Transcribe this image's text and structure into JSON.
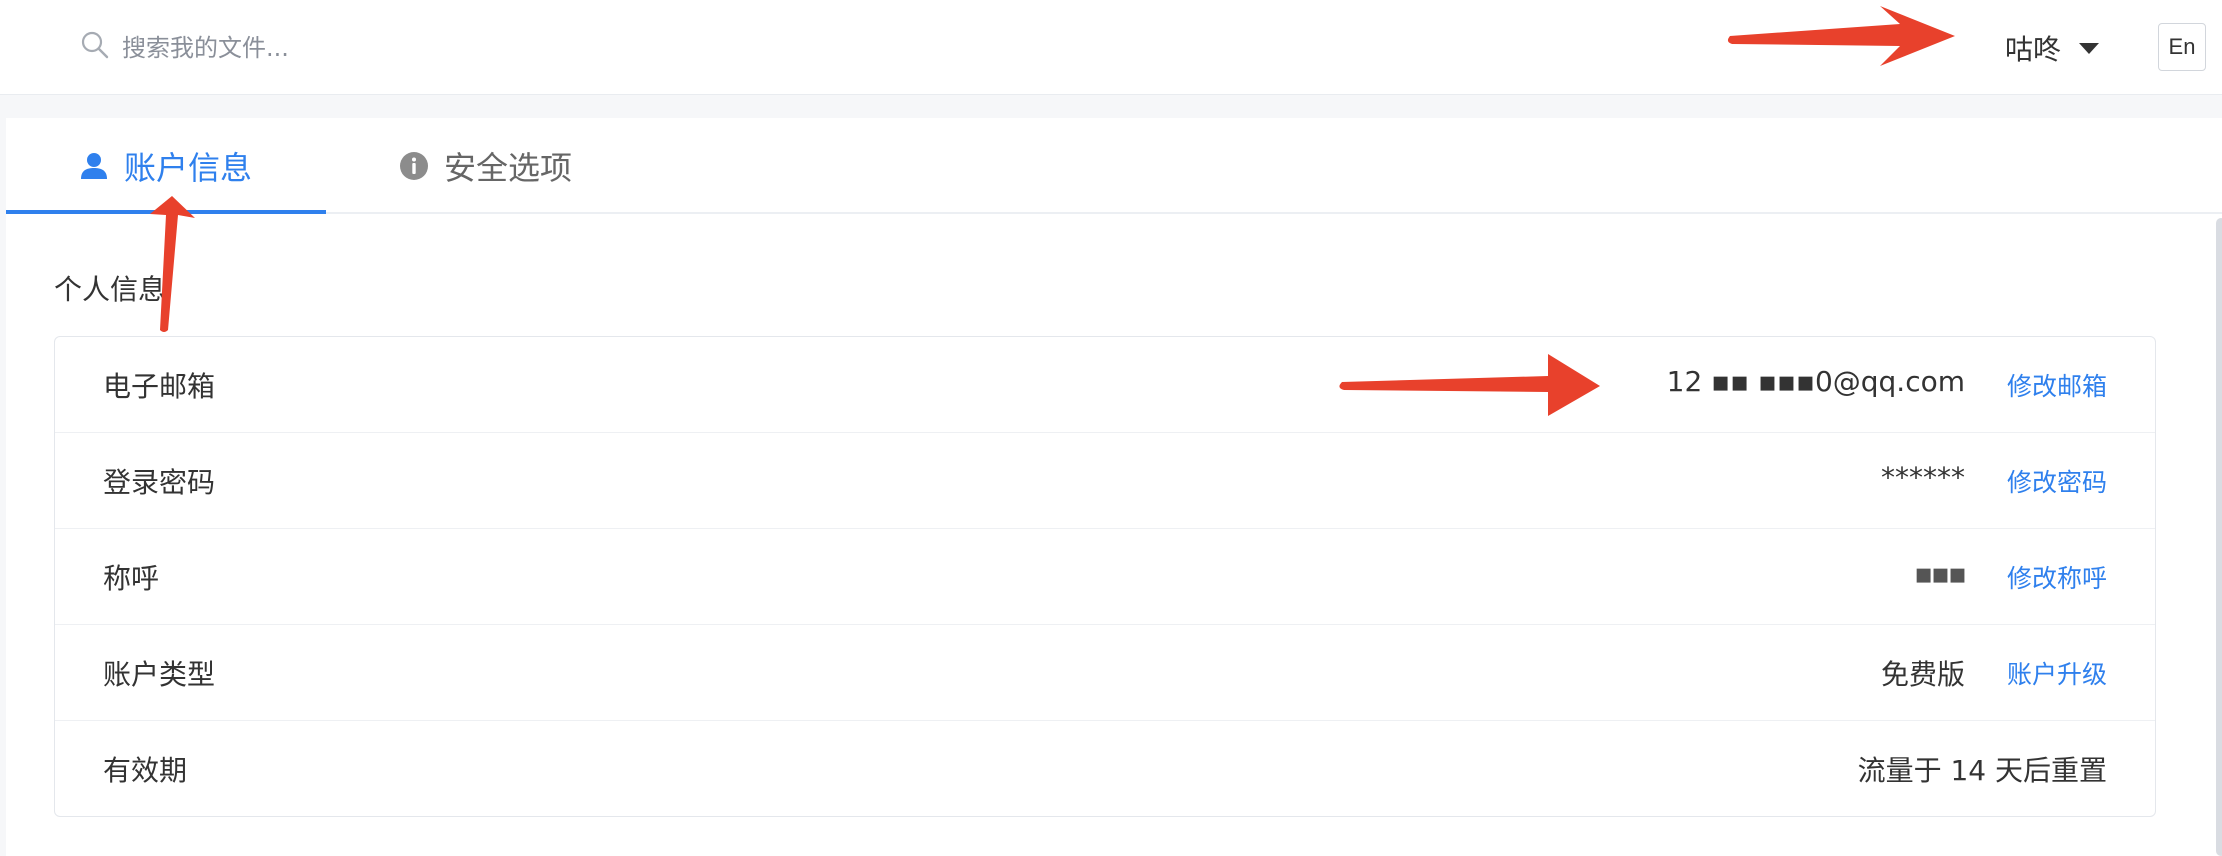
{
  "search": {
    "placeholder": "搜索我的文件...",
    "value": ""
  },
  "user": {
    "name": "咕咚"
  },
  "lang_button": "En",
  "tabs": [
    {
      "label": "账户信息",
      "icon": "user-icon",
      "active": true
    },
    {
      "label": "安全选项",
      "icon": "info-icon",
      "active": false
    }
  ],
  "section_title": "个人信息",
  "rows": [
    {
      "label": "电子邮箱",
      "value": "12 ▪▪ ▪▪▪0@qq.com",
      "action": "修改邮箱"
    },
    {
      "label": "登录密码",
      "value": "******",
      "action": "修改密码"
    },
    {
      "label": "称呼",
      "value": "▪▪▪",
      "action": "修改称呼"
    },
    {
      "label": "账户类型",
      "value": "免费版",
      "action": "账户升级"
    },
    {
      "label": "有效期",
      "value": "流量于 14 天后重置",
      "action": ""
    }
  ],
  "colors": {
    "accent": "#2f80ed",
    "annotation_arrow": "#e8412c"
  }
}
